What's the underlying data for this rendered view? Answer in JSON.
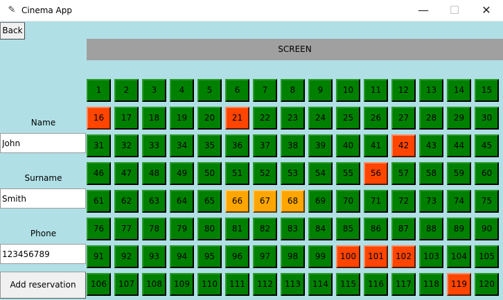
{
  "window": {
    "title": "Cinema App",
    "minimize_glyph": "—",
    "maximize_glyph": "☐",
    "close_glyph": "✕"
  },
  "back_label": "Back",
  "screen_label": "SCREEN",
  "form": {
    "name_label": "Name",
    "name_value": "John",
    "surname_label": "Surname",
    "surname_value": "Smith",
    "phone_label": "Phone",
    "phone_value": "123456789",
    "submit_label": "Add reservation"
  },
  "seat_colors": {
    "available": "#008000",
    "reserved": "#ff4500",
    "selected": "#ffa500"
  },
  "seat_grid": {
    "rows": 8,
    "cols": 15
  },
  "reserved_seats": [
    16,
    21,
    42,
    56,
    100,
    101,
    102,
    119
  ],
  "selected_seats": [
    66,
    67,
    68
  ]
}
